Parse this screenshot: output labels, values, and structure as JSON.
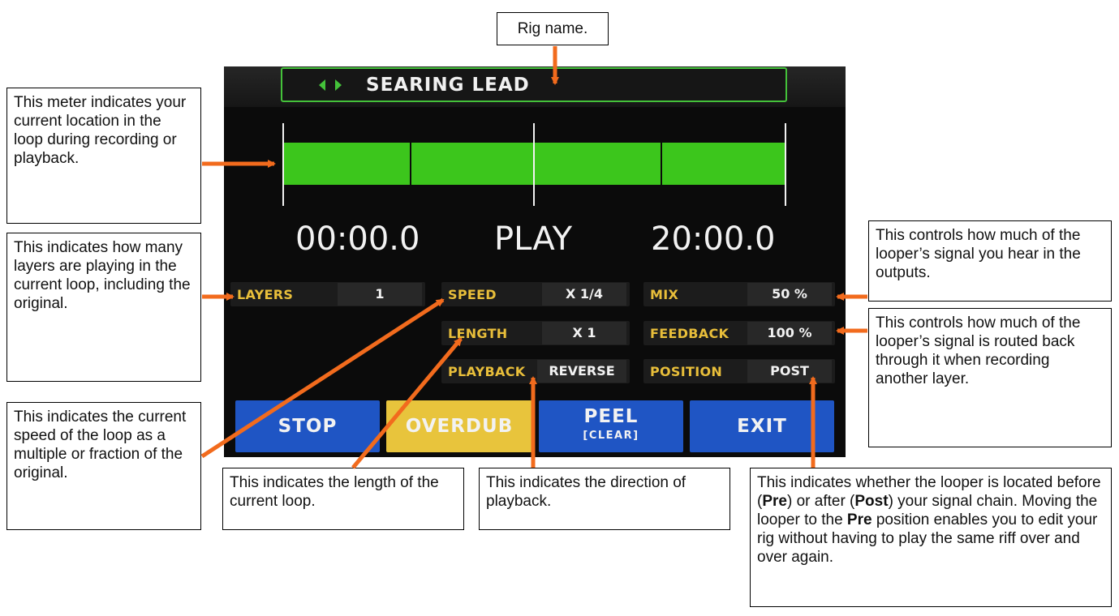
{
  "looper": {
    "rig_name": "SEARING LEAD",
    "elapsed_time": "00:00.0",
    "state": "PLAY",
    "total_time": "20:00.0",
    "meter_fill": 1.0,
    "params": {
      "layers": {
        "label": "LAYERS",
        "value": "1"
      },
      "speed": {
        "label": "SPEED",
        "value": "X 1/4"
      },
      "length": {
        "label": "LENGTH",
        "value": "X 1"
      },
      "playback": {
        "label": "PLAYBACK",
        "value": "REVERSE"
      },
      "mix": {
        "label": "MIX",
        "value": "50 %"
      },
      "feedback": {
        "label": "FEEDBACK",
        "value": "100 %"
      },
      "position": {
        "label": "POSITION",
        "value": "POST"
      }
    },
    "buttons": {
      "stop": "STOP",
      "overdub": "OVERDUB",
      "peel": "PEEL",
      "peel_sub": "[CLEAR]",
      "exit": "EXIT"
    }
  },
  "colors": {
    "accent_green": "#44c23a",
    "meter_green": "#3cc61c",
    "label_yellow": "#e8be3a",
    "button_blue": "#1f55c4",
    "button_yellow": "#e8c43c",
    "arrow_orange": "#f26b1d"
  },
  "callouts": {
    "rig_name": "Rig name.",
    "meter": "This meter indicates your current location in the loop during recording or playback.",
    "layers": "This indicates how many layers are playing in the current loop, including the original.",
    "speed": "This indicates the current speed of the loop as a multiple or fraction of the original.",
    "length": "This indicates the length of the current loop.",
    "playback": "This indicates the direction of playback.",
    "mix": "This controls how much of the looper’s signal you hear in the outputs.",
    "feedback": "This controls how much of the looper’s signal is routed back through it when recording another layer.",
    "position": {
      "t1": "This indicates whether the looper is located before (",
      "pre1": "Pre",
      "t2": ") or after (",
      "post": "Post",
      "t3": ") your signal chain. Moving the looper to the ",
      "pre2": "Pre",
      "t4": " position enables you to edit your rig without having to play the same riff over and over again."
    }
  }
}
